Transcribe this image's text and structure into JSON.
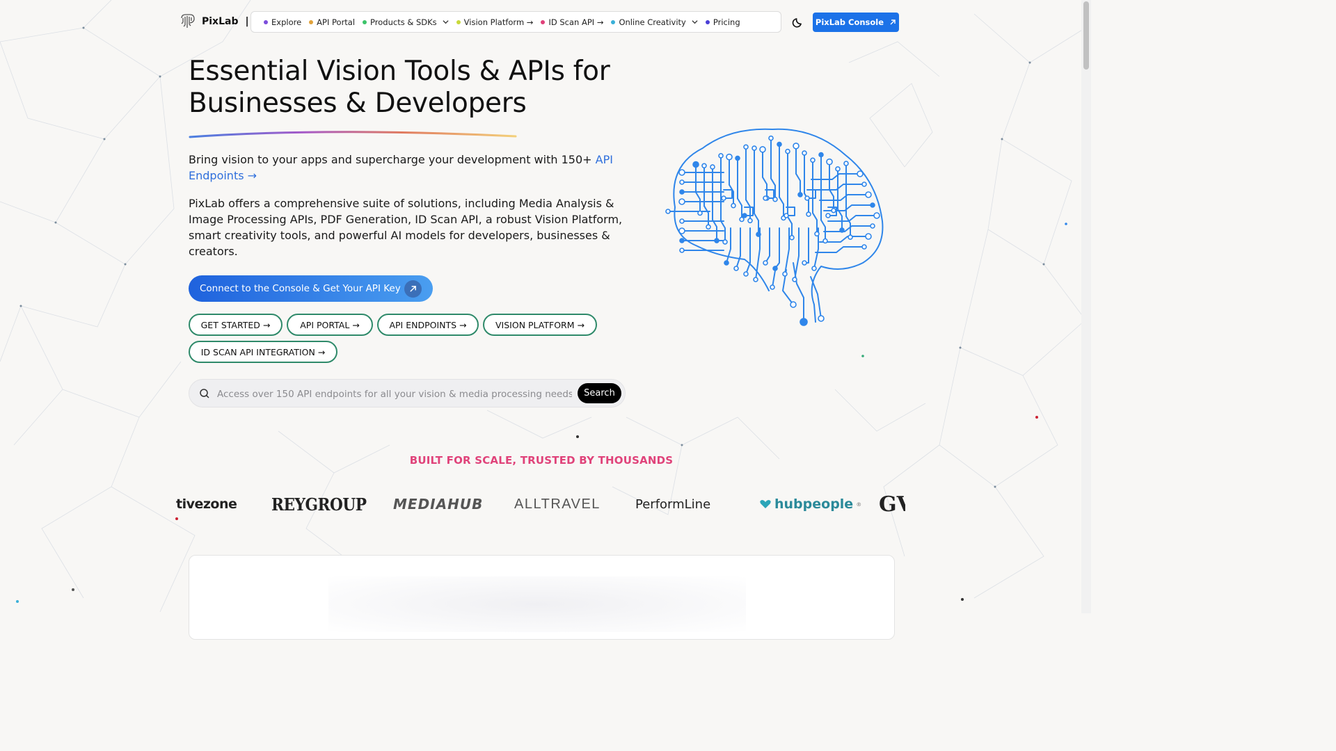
{
  "header": {
    "brand": "PixLab",
    "brand_cursor": "|",
    "nav": [
      {
        "label": "Explore",
        "dot": "#7c4ddb",
        "dropdown": false
      },
      {
        "label": "API Portal",
        "dot": "#e0a23b",
        "dropdown": false
      },
      {
        "label": "Products & SDKs",
        "dot": "#3cc46a",
        "dropdown": true
      },
      {
        "label": "Vision Platform →",
        "dot": "#c9d93a",
        "dropdown": false
      },
      {
        "label": "ID Scan API →",
        "dot": "#e0407a",
        "dropdown": false
      },
      {
        "label": "Online Creativity",
        "dot": "#3ab0d8",
        "dropdown": true
      },
      {
        "label": "Pricing",
        "dot": "#4a3fd6",
        "dropdown": false
      }
    ],
    "theme_icon": "moon-icon",
    "console_button": "PixLab Console"
  },
  "hero": {
    "title_line1": "Essential Vision Tools & APIs for",
    "title_line2": "Businesses & Developers",
    "lead_text": "Bring vision to your apps and supercharge your development with 150+ ",
    "lead_link": "API Endpoints →",
    "description": "PixLab offers a comprehensive suite of solutions, including Media Analysis & Image Processing APIs, PDF Generation, ID Scan API, a robust Vision Platform, smart creativity tools, and powerful AI models for developers, businesses & creators.",
    "cta": "Connect to the Console & Get Your API Key",
    "pills": [
      "GET STARTED →",
      "API PORTAL →",
      "API ENDPOINTS →",
      "VISION PLATFORM →",
      "ID SCAN API INTEGRATION →"
    ]
  },
  "search": {
    "placeholder": "Access over 150 API endpoints for all your vision & media processing needs.",
    "value": "",
    "button": "Search"
  },
  "trusted": {
    "heading": "BUILT FOR SCALE, TRUSTED BY THOUSANDS",
    "logos": [
      "tivezone",
      "REYGROUP",
      "MEDIAHUB",
      "ALLTRAVEL",
      "PerformLine",
      "hubpeople",
      "GV"
    ],
    "hubpeople_mark": "®"
  },
  "colors": {
    "accent": "#1b72e8",
    "pill_border": "#2f8a6a",
    "trusted_heading": "#e0437a",
    "brain": "#2f86ea"
  }
}
